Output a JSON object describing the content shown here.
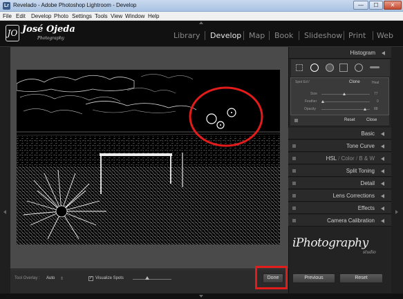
{
  "window": {
    "title": "Revelado - Adobe Photoshop Lightroom - Develop",
    "min_glyph": "—",
    "max_glyph": "☐",
    "close_glyph": "✕"
  },
  "menu": [
    "File",
    "Edit",
    "Develop",
    "Photo",
    "Settings",
    "Tools",
    "View",
    "Window",
    "Help"
  ],
  "identity": {
    "name": "José Ojeda",
    "sub": "Photography",
    "mark": "JO"
  },
  "modules": [
    {
      "label": "Library",
      "active": false
    },
    {
      "label": "Develop",
      "active": true
    },
    {
      "label": "Map",
      "active": false
    },
    {
      "label": "Book",
      "active": false
    },
    {
      "label": "Slideshow",
      "active": false
    },
    {
      "label": "Print",
      "active": false
    },
    {
      "label": "Web",
      "active": false
    }
  ],
  "right_panel": {
    "histogram": "Histogram",
    "spot_removal": {
      "brush_label": "Spot Ed / ",
      "clone": "Clone",
      "heal": "Heal",
      "size_label": "Size",
      "size_value": "77",
      "feather_label": "Feather",
      "feather_value": "0",
      "opacity_label": "Opacity",
      "opacity_value": "88",
      "reset": "Reset",
      "close": "Close"
    },
    "panels": {
      "basic": "Basic",
      "tone_curve": "Tone Curve",
      "hsl": "HSL",
      "color": "Color",
      "bw": "B & W",
      "split_toning": "Split Toning",
      "detail": "Detail",
      "lens_corrections": "Lens Corrections",
      "effects": "Effects",
      "camera_calibration": "Camera Calibration"
    },
    "watermark": {
      "text": "iPhotography",
      "sub": "studio"
    }
  },
  "toolbar": {
    "overlay_label": "Tool Overlay :",
    "overlay_value": "Auto",
    "visualize_label": "Visualize Spots",
    "visualize_checked": true,
    "check_glyph": "✓"
  },
  "buttons": {
    "done": "Done",
    "previous": "Previous",
    "reset": "Reset"
  },
  "colors": {
    "annotation": "#e21b1b",
    "panel": "#232323",
    "workspace": "#4a4a4a"
  }
}
